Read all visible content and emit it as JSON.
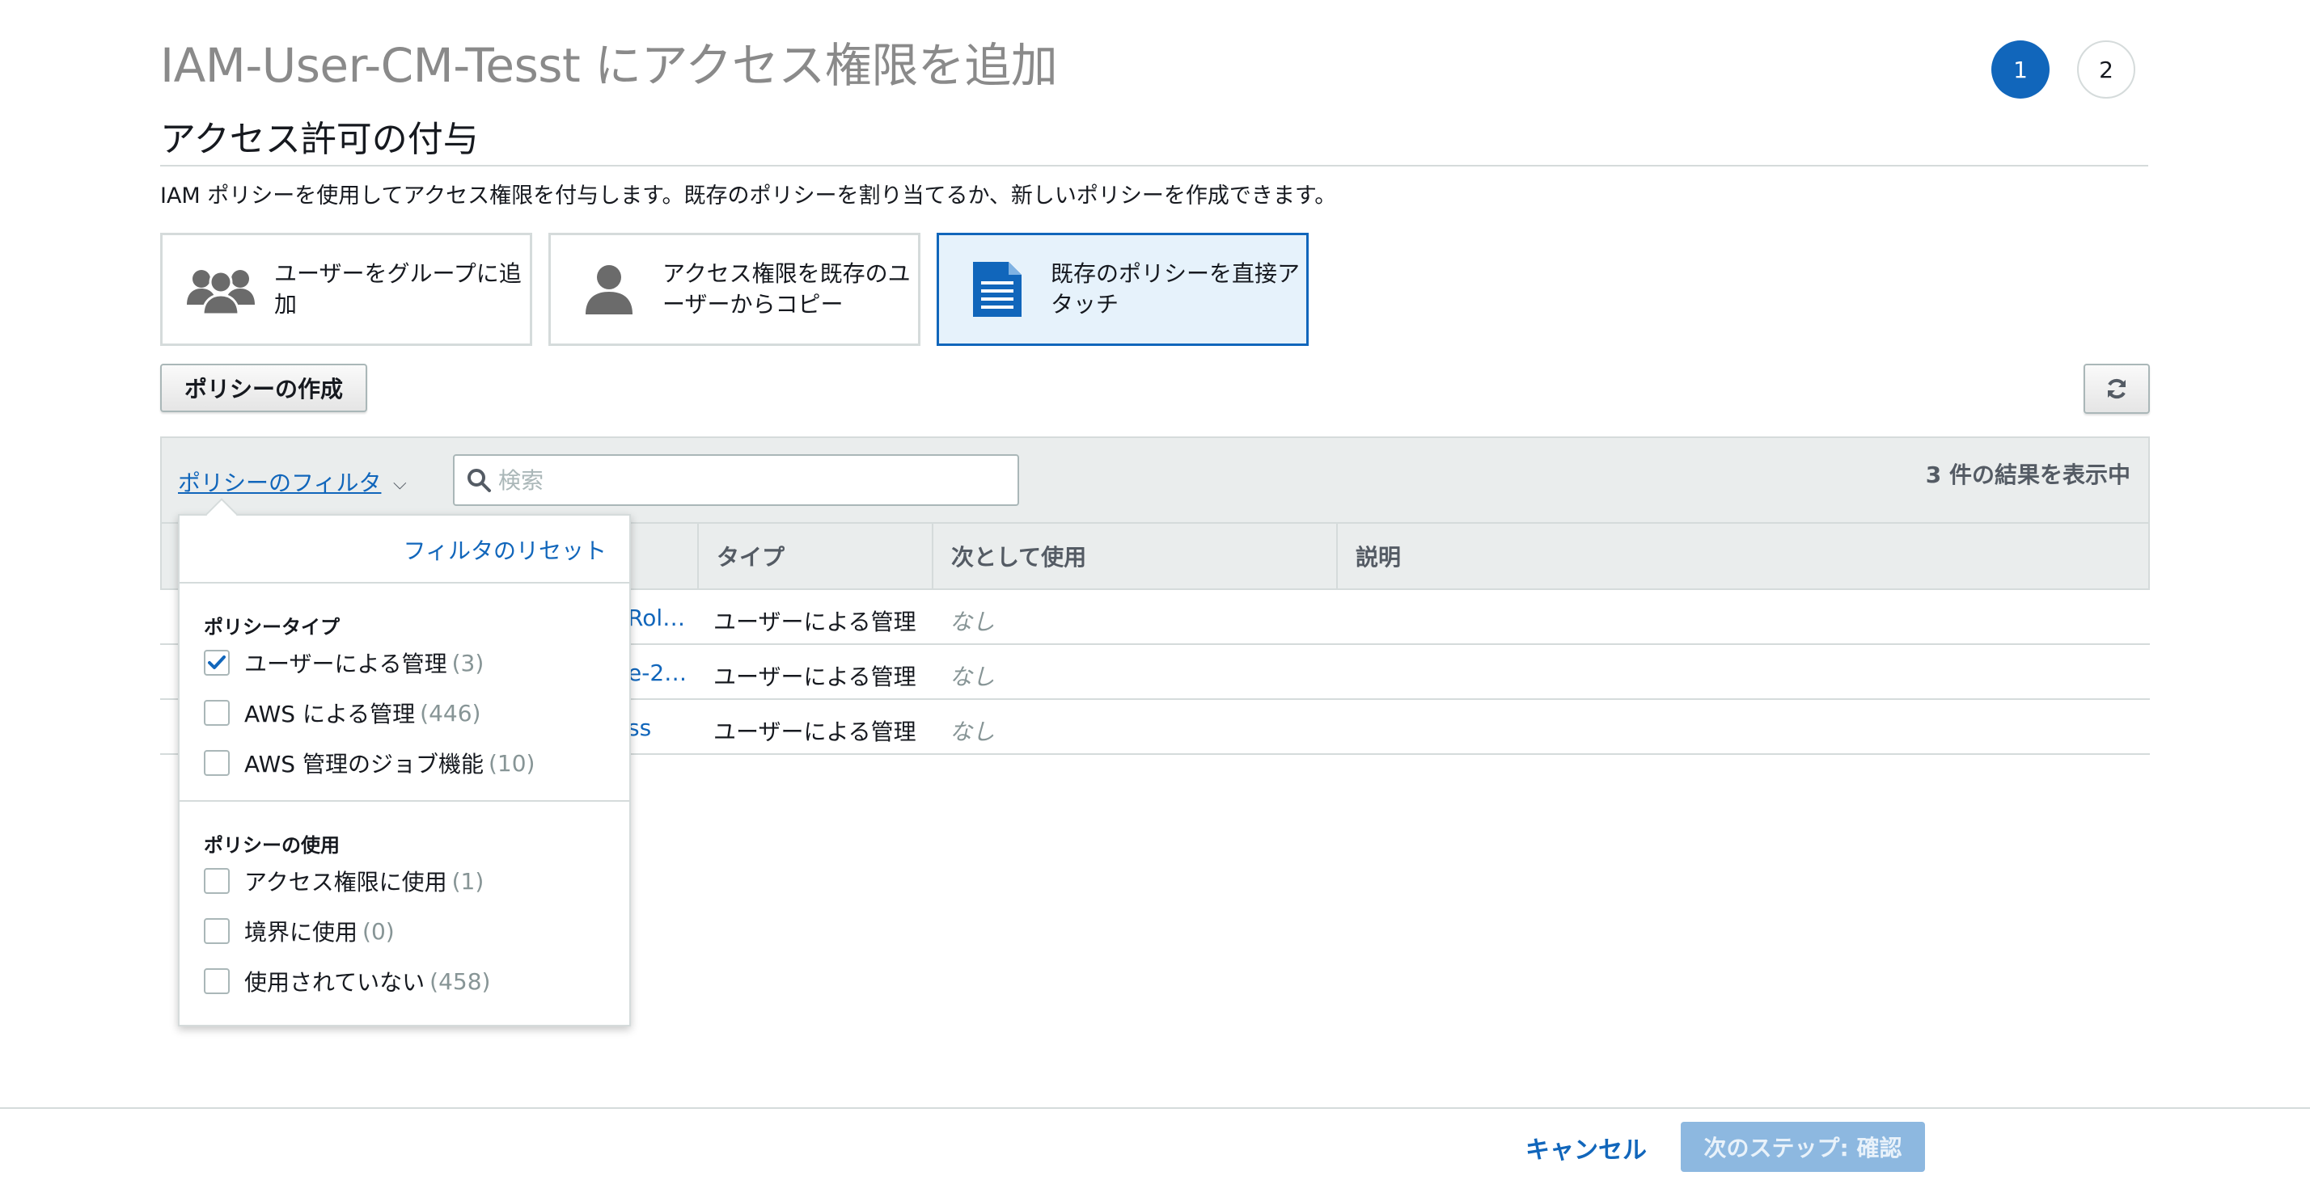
{
  "header": {
    "title": "IAM-User-CM-Tesst にアクセス権限を追加",
    "steps": [
      "1",
      "2"
    ]
  },
  "section": {
    "title": "アクセス許可の付与",
    "description": "IAM ポリシーを使用してアクセス権限を付与します。既存のポリシーを割り当てるか、新しいポリシーを作成できます。"
  },
  "options": [
    {
      "label": "ユーザーをグループに追加",
      "icon": "user-group-icon",
      "selected": false
    },
    {
      "label": "アクセス権限を既存のユーザーからコピー",
      "icon": "user-icon",
      "selected": false
    },
    {
      "label": "既存のポリシーを直接アタッチ",
      "icon": "document-icon",
      "selected": true
    }
  ],
  "toolbar": {
    "create_policy": "ポリシーの作成",
    "refresh_icon": "refresh-icon"
  },
  "filter": {
    "label": "ポリシーのフィルタ",
    "search_placeholder": "検索",
    "result_count": "3 件の結果を表示中"
  },
  "table": {
    "columns": [
      "タイプ",
      "次として使用",
      "説明"
    ],
    "rows": [
      {
        "name_fragment": "Rol…",
        "type": "ユーザーによる管理",
        "usage": "なし"
      },
      {
        "name_fragment": "e-2…",
        "type": "ユーザーによる管理",
        "usage": "なし"
      },
      {
        "name_fragment": "ss",
        "type": "ユーザーによる管理",
        "usage": "なし"
      }
    ]
  },
  "filter_dropdown": {
    "reset": "フィルタのリセット",
    "policy_type_heading": "ポリシータイプ",
    "policy_types": [
      {
        "label": "ユーザーによる管理",
        "count": "(3)",
        "checked": true
      },
      {
        "label": "AWS による管理",
        "count": "(446)",
        "checked": false
      },
      {
        "label": "AWS 管理のジョブ機能",
        "count": "(10)",
        "checked": false
      }
    ],
    "policy_usage_heading": "ポリシーの使用",
    "policy_usages": [
      {
        "label": "アクセス権限に使用",
        "count": "(1)",
        "checked": false
      },
      {
        "label": "境界に使用",
        "count": "(0)",
        "checked": false
      },
      {
        "label": "使用されていない",
        "count": "(458)",
        "checked": false
      }
    ]
  },
  "footer": {
    "cancel": "キャンセル",
    "next": "次のステップ: 確認"
  },
  "colors": {
    "accent": "#1166bb",
    "disabled_button": "#8db8e0",
    "selected_card_bg": "#e6f2fb"
  }
}
